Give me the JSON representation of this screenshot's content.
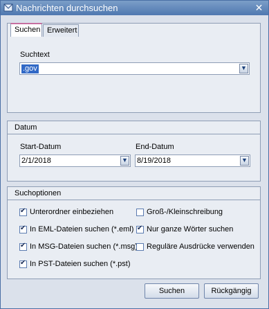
{
  "window": {
    "title": "Nachrichten durchsuchen",
    "close": "✕"
  },
  "tabs": [
    {
      "label": "Suchen",
      "active": true
    },
    {
      "label": "Erweitert",
      "active": false
    }
  ],
  "search": {
    "label": "Suchtext",
    "value": ".gov"
  },
  "date": {
    "group_label": "Datum",
    "start_label": "Start-Datum",
    "start_value": "2/1/2018",
    "end_label": "End-Datum",
    "end_value": "8/19/2018"
  },
  "options": {
    "group_label": "Suchoptionen",
    "items": [
      {
        "label": "Unterordner einbeziehen",
        "checked": true
      },
      {
        "label": "In EML-Dateien suchen (*.eml)",
        "checked": true
      },
      {
        "label": "In MSG-Dateien suchen (*.msg)",
        "checked": true
      },
      {
        "label": "In PST-Dateien suchen (*.pst)",
        "checked": true
      },
      {
        "label": "Groß-/Kleinschreibung",
        "checked": false
      },
      {
        "label": "Nur ganze Wörter suchen",
        "checked": true
      },
      {
        "label": "Reguläre Ausdrücke verwenden",
        "checked": false
      }
    ]
  },
  "buttons": {
    "search": "Suchen",
    "undo": "Rückgängig"
  },
  "colors": {
    "titlebar": "#5b82b8",
    "selection": "#3169c6",
    "tab_accent": "#c76fa0"
  }
}
